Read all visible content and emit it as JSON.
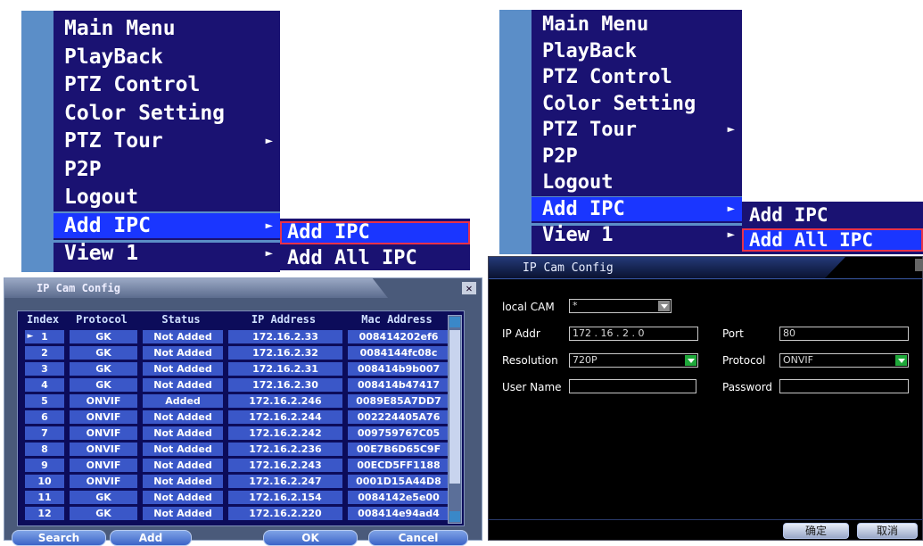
{
  "left_menu": {
    "items": [
      {
        "label": "Main Menu",
        "arrow": false
      },
      {
        "label": "PlayBack",
        "arrow": false
      },
      {
        "label": "PTZ Control",
        "arrow": false
      },
      {
        "label": "Color Setting",
        "arrow": false
      },
      {
        "label": "PTZ Tour",
        "arrow": true
      },
      {
        "label": "P2P",
        "arrow": false
      },
      {
        "label": "Logout",
        "arrow": false
      },
      {
        "label": "Add IPC",
        "arrow": true,
        "selected": true
      },
      {
        "label": "View 1",
        "arrow": true
      }
    ],
    "arrow_glyph": "►",
    "submenu": [
      "Add IPC",
      "Add All IPC"
    ]
  },
  "right_menu": {
    "items": [
      {
        "label": "Main Menu"
      },
      {
        "label": "PlayBack"
      },
      {
        "label": "PTZ Control"
      },
      {
        "label": "Color Setting"
      },
      {
        "label": "PTZ Tour"
      },
      {
        "label": "P2P"
      },
      {
        "label": "Logout"
      },
      {
        "label": "Add IPC"
      },
      {
        "label": "View 1"
      }
    ],
    "submenu": [
      "Add IPC",
      "Add All IPC"
    ]
  },
  "ipcam_list_dialog": {
    "title": "IP Cam Config",
    "close_glyph": "✕",
    "columns": [
      "Index",
      "Protocol",
      "Status",
      "IP Address",
      "Mac Address"
    ],
    "selected_marker": "►",
    "rows": [
      {
        "index": "1",
        "protocol": "GK",
        "status": "Not Added",
        "ip": "172.16.2.33",
        "mac": "008414202ef6"
      },
      {
        "index": "2",
        "protocol": "GK",
        "status": "Not Added",
        "ip": "172.16.2.32",
        "mac": "0084144fc08c"
      },
      {
        "index": "3",
        "protocol": "GK",
        "status": "Not Added",
        "ip": "172.16.2.31",
        "mac": "008414b9b007"
      },
      {
        "index": "4",
        "protocol": "GK",
        "status": "Not Added",
        "ip": "172.16.2.30",
        "mac": "008414b47417"
      },
      {
        "index": "5",
        "protocol": "ONVIF",
        "status": "Added",
        "ip": "172.16.2.246",
        "mac": "0089E85A7DD7"
      },
      {
        "index": "6",
        "protocol": "ONVIF",
        "status": "Not Added",
        "ip": "172.16.2.244",
        "mac": "002224405A76"
      },
      {
        "index": "7",
        "protocol": "ONVIF",
        "status": "Not Added",
        "ip": "172.16.2.242",
        "mac": "009759767C05"
      },
      {
        "index": "8",
        "protocol": "ONVIF",
        "status": "Not Added",
        "ip": "172.16.2.236",
        "mac": "00E7B6D65C9F"
      },
      {
        "index": "9",
        "protocol": "ONVIF",
        "status": "Not Added",
        "ip": "172.16.2.243",
        "mac": "00ECD5FF1188"
      },
      {
        "index": "10",
        "protocol": "ONVIF",
        "status": "Not Added",
        "ip": "172.16.2.247",
        "mac": "0001D15A44D8"
      },
      {
        "index": "11",
        "protocol": "GK",
        "status": "Not Added",
        "ip": "172.16.2.154",
        "mac": "0084142e5e00"
      },
      {
        "index": "12",
        "protocol": "GK",
        "status": "Not Added",
        "ip": "172.16.2.220",
        "mac": "008414e94ad4"
      }
    ],
    "buttons": {
      "search": "Search",
      "add": "Add",
      "ok": "OK",
      "cancel": "Cancel"
    }
  },
  "ipcam_form_dialog": {
    "title": "IP Cam Config",
    "local_cam_label": "local CAM",
    "local_cam_value": "*",
    "ip_addr_label": "IP Addr",
    "ip_addr_value": "172 . 16 . 2 . 0",
    "port_label": "Port",
    "port_value": "80",
    "resolution_label": "Resolution",
    "resolution_value": "720P",
    "protocol_label": "Protocol",
    "protocol_value": "ONVIF",
    "username_label": "User Name",
    "username_value": "",
    "password_label": "Password",
    "password_value": "",
    "buttons": {
      "confirm": "确定",
      "cancel": "取消"
    }
  },
  "colors": {
    "menu_bg": "#1a1272",
    "menu_selected": "#1a36ff",
    "highlight_border": "#e8324a",
    "cell_bg": "#3a57c8"
  }
}
